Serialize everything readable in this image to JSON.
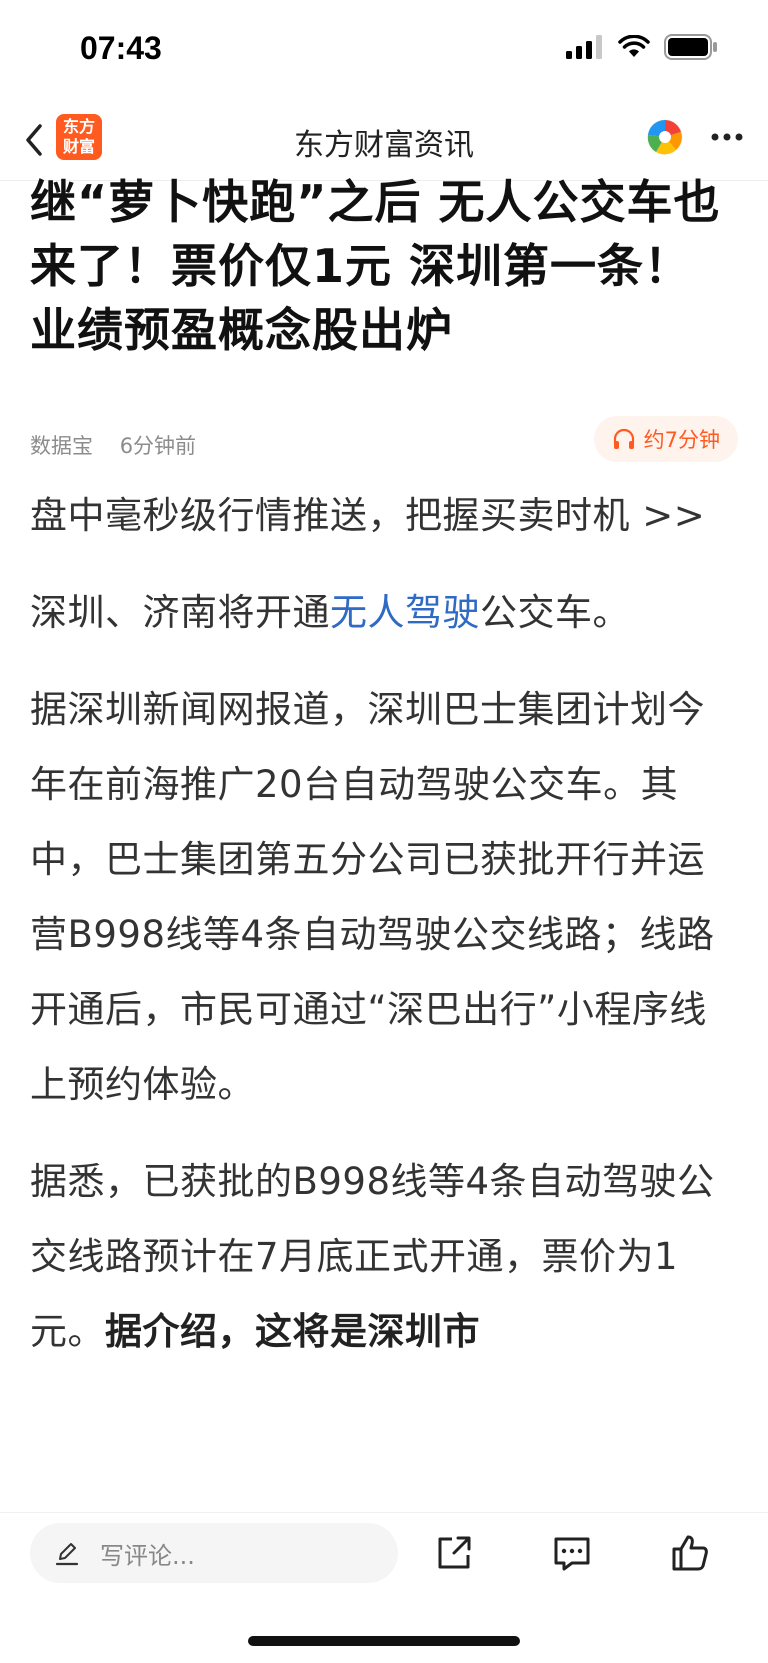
{
  "status": {
    "time": "07:43"
  },
  "nav": {
    "logo_text": "东方财富",
    "title": "东方财富资讯"
  },
  "article": {
    "title": "继“萝卜快跑”之后 无人公交车也来了！票价仅1元 深圳第一条！业绩预盈概念股出炉",
    "source": "数据宝",
    "time": "6分钟前",
    "listen_label": "约7分钟",
    "promo_text": "盘中毫秒级行情推送，把握买卖时机 >>",
    "p1_a": "深圳、济南将开通",
    "p1_link": "无人驾驶",
    "p1_b": "公交车。",
    "p2": "据深圳新闻网报道，深圳巴士集团计划今年在前海推广20台自动驾驶公交车。其中，巴士集团第五分公司已获批开行并运营B998线等4条自动驾驶公交线路；线路开通后，市民可通过“深巴出行”小程序线上预约体验。",
    "p3_a": "据悉，已获批的B998线等4条自动驾驶公交线路预计在7月底正式开通，票价为1元。",
    "p3_bold": "据介绍，这将是深圳市"
  },
  "bottom": {
    "comment_placeholder": "写评论..."
  },
  "colors": {
    "accent": "#ff5a1f",
    "link": "#2f6ac4"
  }
}
